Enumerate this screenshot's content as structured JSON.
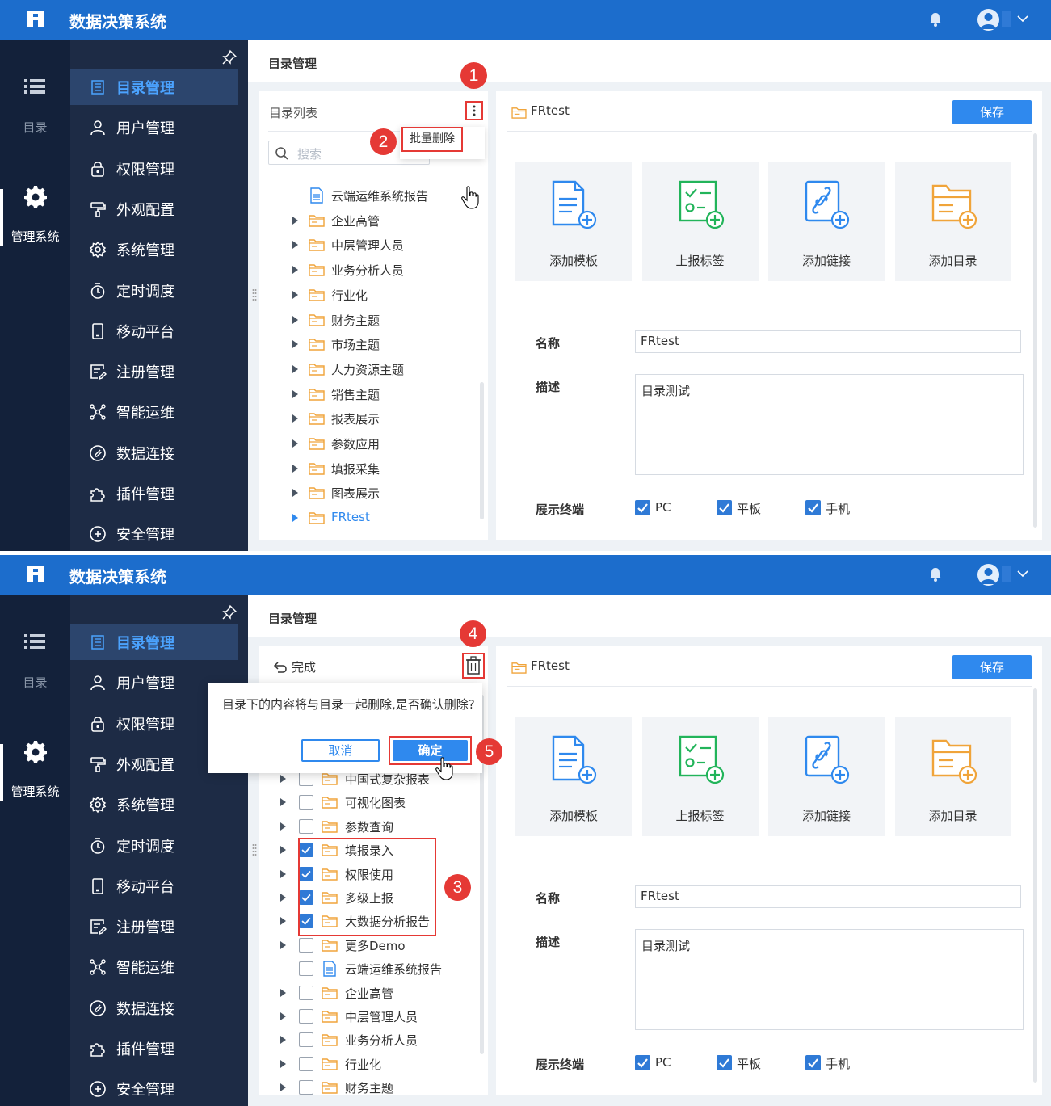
{
  "app": {
    "title": "数据决策系统"
  },
  "leftnav": {
    "catalog_label": "目录",
    "management_label": "管理系统"
  },
  "menu": {
    "items": [
      {
        "label": "目录管理",
        "icon": "list-icon",
        "active": true
      },
      {
        "label": "用户管理",
        "icon": "user-icon"
      },
      {
        "label": "权限管理",
        "icon": "lock-icon"
      },
      {
        "label": "外观配置",
        "icon": "brush-icon"
      },
      {
        "label": "系统管理",
        "icon": "gear-icon"
      },
      {
        "label": "定时调度",
        "icon": "timer-icon"
      },
      {
        "label": "移动平台",
        "icon": "phone-icon"
      },
      {
        "label": "注册管理",
        "icon": "register-icon"
      },
      {
        "label": "智能运维",
        "icon": "network-icon"
      },
      {
        "label": "数据连接",
        "icon": "link-icon"
      },
      {
        "label": "插件管理",
        "icon": "puzzle-icon"
      },
      {
        "label": "安全管理",
        "icon": "shield-icon"
      }
    ]
  },
  "main": {
    "title": "目录管理"
  },
  "panel1": {
    "list_title": "目录列表",
    "search_placeholder": "搜索",
    "batch_delete": "批量删除",
    "tree": [
      {
        "label": "云端运维系统报告",
        "type": "file"
      },
      {
        "label": "企业高管",
        "type": "folder"
      },
      {
        "label": "中层管理人员",
        "type": "folder"
      },
      {
        "label": "业务分析人员",
        "type": "folder"
      },
      {
        "label": "行业化",
        "type": "folder"
      },
      {
        "label": "财务主题",
        "type": "folder"
      },
      {
        "label": "市场主题",
        "type": "folder"
      },
      {
        "label": "人力资源主题",
        "type": "folder"
      },
      {
        "label": "销售主题",
        "type": "folder"
      },
      {
        "label": "报表展示",
        "type": "folder"
      },
      {
        "label": "参数应用",
        "type": "folder"
      },
      {
        "label": "填报采集",
        "type": "folder"
      },
      {
        "label": "图表展示",
        "type": "folder"
      },
      {
        "label": "FRtest",
        "type": "folder",
        "selected": true
      }
    ]
  },
  "panel2": {
    "done_label": "完成",
    "confirm_message": "目录下的内容将与目录一起删除,是否确认删除?",
    "cancel_label": "取消",
    "ok_label": "确定",
    "tree": [
      {
        "label": "中国式复杂报表",
        "type": "folder",
        "checked": false
      },
      {
        "label": "可视化图表",
        "type": "folder",
        "checked": false
      },
      {
        "label": "参数查询",
        "type": "folder",
        "checked": false
      },
      {
        "label": "填报录入",
        "type": "folder",
        "checked": true
      },
      {
        "label": "权限使用",
        "type": "folder",
        "checked": true
      },
      {
        "label": "多级上报",
        "type": "folder",
        "checked": true
      },
      {
        "label": "大数据分析报告",
        "type": "folder",
        "checked": true
      },
      {
        "label": "更多Demo",
        "type": "folder",
        "checked": false
      },
      {
        "label": "云端运维系统报告",
        "type": "file",
        "checked": false
      },
      {
        "label": "企业高管",
        "type": "folder",
        "checked": false
      },
      {
        "label": "中层管理人员",
        "type": "folder",
        "checked": false
      },
      {
        "label": "业务分析人员",
        "type": "folder",
        "checked": false
      },
      {
        "label": "行业化",
        "type": "folder",
        "checked": false
      },
      {
        "label": "财务主题",
        "type": "folder",
        "checked": false
      }
    ]
  },
  "detail": {
    "folder_name": "FRtest",
    "save_label": "保存",
    "cards": [
      {
        "label": "添加模板",
        "icon": "add-template-icon"
      },
      {
        "label": "上报标签",
        "icon": "report-tag-icon"
      },
      {
        "label": "添加链接",
        "icon": "add-link-icon"
      },
      {
        "label": "添加目录",
        "icon": "add-folder-icon"
      }
    ],
    "name_label": "名称",
    "name_value": "FRtest",
    "desc_label": "描述",
    "desc_value": "目录测试",
    "terminal_label": "展示终端",
    "terminals": [
      "PC",
      "平板",
      "手机"
    ]
  },
  "badges": [
    "1",
    "2",
    "3",
    "4",
    "5"
  ],
  "colors": {
    "topbar": "#1c6dcc",
    "accent": "#2f89ee",
    "sidebar": "#1d2b45",
    "highlight": "#e53935"
  }
}
